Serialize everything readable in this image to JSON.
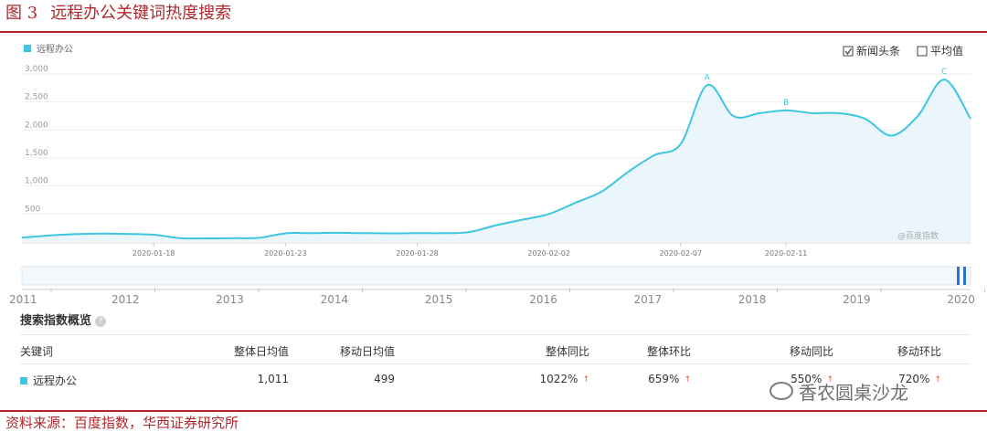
{
  "figure": {
    "number": "图 3",
    "title": "远程办公关键词热度搜索",
    "source": "资料来源：百度指数，华西证券研究所"
  },
  "legend": {
    "series_label": "远程办公",
    "color": "#3ec6e0"
  },
  "toggles": {
    "headline": "新闻头条",
    "average": "平均值"
  },
  "watermark_inner": "@百度指数",
  "chart_data": {
    "type": "area",
    "series": [
      {
        "name": "远程办公",
        "points": [
          [
            "2020-01-13",
            80
          ],
          [
            "2020-01-14",
            115
          ],
          [
            "2020-01-15",
            140
          ],
          [
            "2020-01-16",
            150
          ],
          [
            "2020-01-17",
            145
          ],
          [
            "2020-01-18",
            130
          ],
          [
            "2020-01-19",
            70
          ],
          [
            "2020-01-20",
            65
          ],
          [
            "2020-01-21",
            70
          ],
          [
            "2020-01-22",
            75
          ],
          [
            "2020-01-23",
            155
          ],
          [
            "2020-01-24",
            160
          ],
          [
            "2020-01-25",
            165
          ],
          [
            "2020-01-26",
            158
          ],
          [
            "2020-01-27",
            155
          ],
          [
            "2020-01-28",
            160
          ],
          [
            "2020-01-29",
            158
          ],
          [
            "2020-01-30",
            180
          ],
          [
            "2020-01-31",
            300
          ],
          [
            "2020-02-01",
            400
          ],
          [
            "2020-02-02",
            500
          ],
          [
            "2020-02-03",
            700
          ],
          [
            "2020-02-04",
            900
          ],
          [
            "2020-02-05",
            1250
          ],
          [
            "2020-02-06",
            1550
          ],
          [
            "2020-02-07",
            1750
          ],
          [
            "2020-02-08",
            2800
          ],
          [
            "2020-02-09",
            2250
          ],
          [
            "2020-02-10",
            2300
          ],
          [
            "2020-02-11",
            2350
          ],
          [
            "2020-02-12",
            2300
          ],
          [
            "2020-02-13",
            2300
          ],
          [
            "2020-02-14",
            2200
          ],
          [
            "2020-02-15",
            1900
          ],
          [
            "2020-02-16",
            2250
          ],
          [
            "2020-02-17",
            2900
          ],
          [
            "2020-02-18",
            2200
          ]
        ]
      }
    ],
    "y_ticks": [
      "3,000",
      "2,500",
      "2,000",
      "1,500",
      "1,000",
      "500"
    ],
    "y_tick_values": [
      3000,
      2500,
      2000,
      1500,
      1000,
      500
    ],
    "ylim": [
      0,
      3000
    ],
    "x_ticks": [
      "2020-01-18",
      "2020-01-23",
      "2020-01-28",
      "2020-02-02",
      "2020-02-07",
      "2020-02-11"
    ],
    "annotations": [
      {
        "label": "A",
        "date": "2020-02-08"
      },
      {
        "label": "B",
        "date": "2020-02-11"
      },
      {
        "label": "C",
        "date": "2020-02-17"
      }
    ],
    "grid": true,
    "legend_position": "top-left"
  },
  "timeline": {
    "years": [
      "2011",
      "2012",
      "2013",
      "2014",
      "2015",
      "2016",
      "2017",
      "2018",
      "2019",
      "2020"
    ]
  },
  "overview": {
    "title": "搜索指数概览",
    "headers": {
      "keyword": "关键词",
      "overall_daily": "整体日均值",
      "mobile_daily": "移动日均值",
      "overall_yoy": "整体同比",
      "overall_mom": "整体环比",
      "mobile_yoy": "移动同比",
      "mobile_mom": "移动环比"
    },
    "row": {
      "keyword": "远程办公",
      "overall_daily": "1,011",
      "mobile_daily": "499",
      "overall_yoy": "1022%",
      "overall_mom": "659%",
      "mobile_yoy": "550%",
      "mobile_mom": "720%"
    }
  },
  "watermark": "香农圆桌沙龙"
}
